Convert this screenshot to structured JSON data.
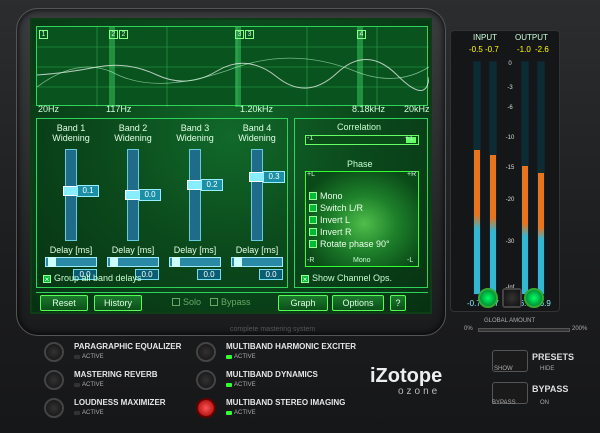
{
  "spectrum": {
    "freq_labels": [
      "20Hz",
      "117Hz",
      "1.20kHz",
      "8.18kHz",
      "20kHz"
    ],
    "crossover_tags": [
      "1",
      "2",
      "2",
      "3",
      "3",
      "4"
    ]
  },
  "bands": [
    {
      "title": "Band 1",
      "subtitle": "Widening",
      "value": "0.1",
      "delay_label": "Delay [ms]",
      "delay_value": "0.0"
    },
    {
      "title": "Band 2",
      "subtitle": "Widening",
      "value": "0.0",
      "delay_label": "Delay [ms]",
      "delay_value": "0.0"
    },
    {
      "title": "Band 3",
      "subtitle": "Widening",
      "value": "0.2",
      "delay_label": "Delay [ms]",
      "delay_value": "0.0"
    },
    {
      "title": "Band 4",
      "subtitle": "Widening",
      "value": "0.3",
      "delay_label": "Delay [ms]",
      "delay_value": "0.0"
    }
  ],
  "group_delays": "Group all band delays",
  "correlation": {
    "title": "Correlation",
    "left": "-1",
    "right": "+1"
  },
  "phase": {
    "title": "Phase",
    "corner_tl": "+L",
    "corner_tr": "+R",
    "corner_bl": "-R",
    "corner_br": "-L",
    "bottom": "Mono",
    "options": [
      "Mono",
      "Switch L/R",
      "Invert L",
      "Invert R",
      "Rotate phase 90°"
    ],
    "show_ops": "Show Channel Ops."
  },
  "buttons": {
    "reset": "Reset",
    "history": "History",
    "solo": "Solo",
    "bypass": "Bypass",
    "graph": "Graph",
    "options": "Options",
    "help": "?"
  },
  "caption": "complete mastering system",
  "meters": {
    "input_label": "INPUT",
    "output_label": "OUTPUT",
    "input_peaks": [
      "-0.5",
      "-0.7"
    ],
    "output_peaks": [
      "-1.0",
      "-2.6"
    ],
    "input_bottom": [
      "-0.7",
      "-0.7"
    ],
    "output_bottom": [
      "-6.9",
      "-6.9"
    ],
    "scale": [
      "0",
      "-3",
      "-6",
      "-10",
      "-15",
      "-20",
      "-30",
      "-Inf"
    ],
    "input_levels": [
      0.62,
      0.6
    ],
    "output_levels": [
      0.55,
      0.52
    ]
  },
  "global_amount": {
    "label": "GLOBAL AMOUNT",
    "min": "0%",
    "max": "200%"
  },
  "modules": [
    {
      "name": "PARAGRAPHIC EQUALIZER",
      "active": "ACTIVE",
      "on": false
    },
    {
      "name": "MASTERING REVERB",
      "active": "ACTIVE",
      "on": false
    },
    {
      "name": "LOUDNESS MAXIMIZER",
      "active": "ACTIVE",
      "on": false
    },
    {
      "name": "MULTIBAND HARMONIC EXCITER",
      "active": "ACTIVE",
      "on": true
    },
    {
      "name": "MULTIBAND DYNAMICS",
      "active": "ACTIVE",
      "on": true
    },
    {
      "name": "MULTIBAND STEREO IMAGING",
      "active": "ACTIVE",
      "on": true
    }
  ],
  "presets": {
    "label": "PRESETS",
    "show": "SHOW",
    "hide": "HIDE"
  },
  "bypass_side": {
    "label": "BYPASS",
    "bypass": "BYPASS",
    "on": "ON"
  },
  "logo": {
    "brand": "iZotope",
    "product": "ozone"
  },
  "colors": {
    "accent": "#2fd25a",
    "screen": "#0b4a1c",
    "meter_orange": "#e8741e",
    "meter_cyan": "#34b7d0"
  }
}
